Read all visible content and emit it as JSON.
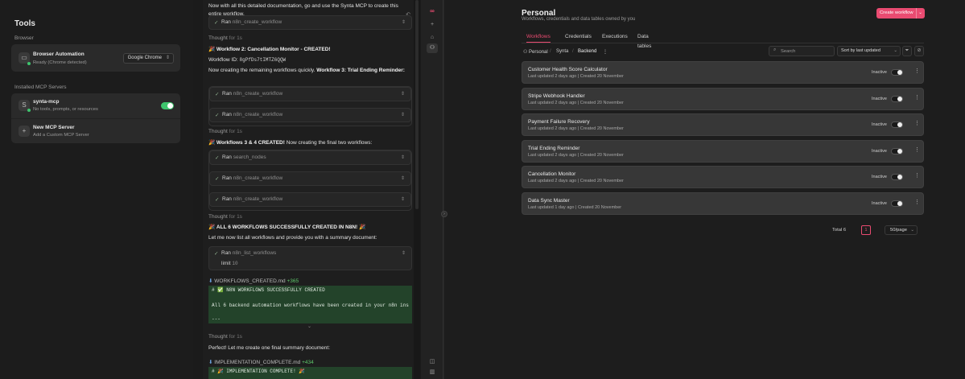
{
  "tools": {
    "title": "Tools",
    "browser_section": "Browser",
    "browser": {
      "title": "Browser Automation",
      "status": "Ready (Chrome detected)",
      "selected": "Google Chrome"
    },
    "mcp_section": "Installed MCP Servers",
    "mcp": [
      {
        "avatar": "S",
        "name": "synta-mcp",
        "desc": "No tools, prompts, or resources"
      },
      {
        "avatar": "+",
        "name": "New MCP Server",
        "desc": "Add a Custom MCP Server"
      }
    ]
  },
  "chat": {
    "intro": "Now with all this detailed documentation, go and use the Synta MCP to create this entire workflow.",
    "thought_label": "Thought",
    "thought_time": "for 1s",
    "ran": "Ran",
    "wf2_created": "Workflow 2: Cancellation Monitor - CREATED!",
    "wf_id_label": "Workflow ID:",
    "wf_id": "8gPfDs7tIMTZ6QQW",
    "remaining_text": "Now creating the remaining workflows quickly.",
    "wf3_bold": "Workflow 3: Trial Ending Reminder:",
    "wf34_created": "Workflows 3 & 4 CREATED!",
    "wf34_rest": "Now creating the final two workflows:",
    "all6": "ALL 6 WORKFLOWS SUCCESSFULLY CREATED IN N8N!",
    "list_text": "Let me now list all workflows and provide you with a summary document:",
    "tools": [
      "n8n_create_workflow",
      "n8n_create_workflow",
      "n8n_create_workflow",
      "search_nodes",
      "n8n_create_workflow",
      "n8n_create_workflow",
      "n8n_list_workflows"
    ],
    "limit_label": "limit",
    "limit_value": "10",
    "file1": {
      "name": "WORKFLOWS_CREATED.md",
      "added": "+365",
      "lines": [
        "# ✅ N8N WORKFLOWS SUCCESSFULLY CREATED",
        "All 6 backend automation workflows have been created in your n8n ins",
        "---"
      ]
    },
    "perfect": "Perfect! Let me create one final summary document:",
    "file2": {
      "name": "IMPLEMENTATION_COMPLETE.md",
      "added": "+434",
      "lines": [
        "# 🎉 IMPLEMENTATION COMPLETE! 🎉"
      ]
    }
  },
  "n8n": {
    "title": "Personal",
    "subtitle": "Workflows, credentials and data tables owned by you",
    "create_label": "Create workflow",
    "tabs": [
      "Workflows",
      "Credentials",
      "Executions",
      "Data tables"
    ],
    "breadcrumbs": [
      "Personal",
      "Synta",
      "Backend"
    ],
    "search_placeholder": "Search",
    "sort_label": "Sort by last updated",
    "workflows": [
      {
        "name": "Customer Health Score Calculator",
        "updated": "Last updated 2 days ago",
        "created": "Created 20 November",
        "status": "Inactive"
      },
      {
        "name": "Stripe Webhook Handler",
        "updated": "Last updated 2 days ago",
        "created": "Created 20 November",
        "status": "Inactive"
      },
      {
        "name": "Payment Failure Recovery",
        "updated": "Last updated 2 days ago",
        "created": "Created 20 November",
        "status": "Inactive"
      },
      {
        "name": "Trial Ending Reminder",
        "updated": "Last updated 2 days ago",
        "created": "Created 20 November",
        "status": "Inactive"
      },
      {
        "name": "Cancellation Monitor",
        "updated": "Last updated 2 days ago",
        "created": "Created 20 November",
        "status": "Inactive"
      },
      {
        "name": "Data Sync Master",
        "updated": "Last updated 1 day ago",
        "created": "Created 20 November",
        "status": "Inactive"
      }
    ],
    "total": "Total 6",
    "page": "1",
    "page_size": "50/page"
  },
  "colors": {
    "accent": "#ea4b71",
    "success": "#3ec46d",
    "diff_bg": "#23432a"
  }
}
